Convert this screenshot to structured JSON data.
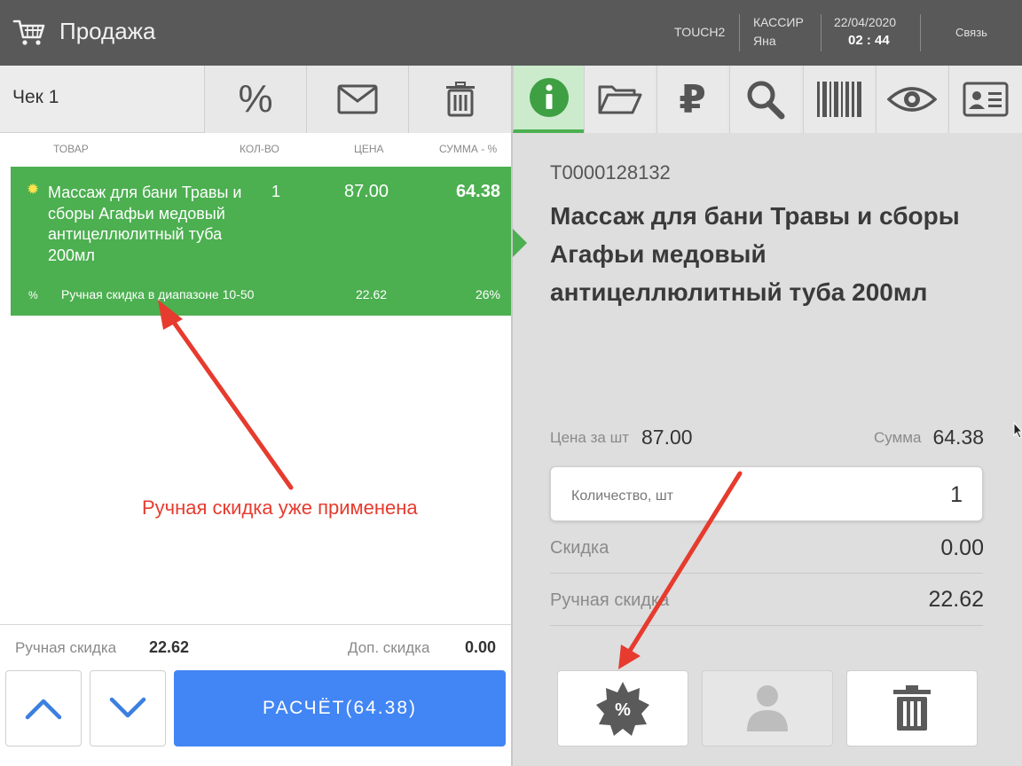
{
  "header": {
    "title": "Продажа",
    "terminal": "TOUCH2",
    "cashier_title": "КАССИР",
    "cashier_name": "Яна",
    "date": "22/04/2020",
    "time": "02 : 44",
    "link_label": "Связь"
  },
  "receipt": {
    "title": "Чек 1",
    "discount_button_symbol": "%"
  },
  "columns": {
    "item": "ТОВАР",
    "qty": "КОЛ-ВО",
    "price": "ЦЕНА",
    "sum": "СУММА - %"
  },
  "items": [
    {
      "name": "Массаж для бани Травы и сборы Агафьи медовый антицеллюлитный туба 200мл",
      "qty": "1",
      "price": "87.00",
      "sum": "64.38",
      "discount": {
        "symbol": "%",
        "label": "Ручная скидка в диапазоне 10-50",
        "amount": "22.62",
        "percent": "26%"
      }
    }
  ],
  "footer": {
    "manual_discount_label": "Ручная скидка",
    "manual_discount_value": "22.62",
    "extra_discount_label": "Доп. скидка",
    "extra_discount_value": "0.00",
    "pay_button": "РАСЧЁТ(64.38)"
  },
  "toolbar": {
    "tools": [
      "info-icon",
      "folder-icon",
      "ruble-icon",
      "search-icon",
      "barcode-icon",
      "eye-icon",
      "id-card-icon"
    ],
    "ruble_symbol": "₽"
  },
  "details": {
    "code": "Т0000128132",
    "name": "Массаж для бани Травы и сборы Агафьи медовый антицеллюлитный туба 200мл",
    "unit_price_label": "Цена за шт",
    "unit_price": "87.00",
    "sum_label": "Сумма",
    "sum": "64.38",
    "quantity_label": "Количество, шт",
    "quantity": "1",
    "discount_label": "Скидка",
    "discount": "0.00",
    "manual_discount_label": "Ручная скидка",
    "manual_discount": "22.62",
    "discount_badge_symbol": "%"
  },
  "annotation": {
    "text": "Ручная скидка уже применена",
    "color": "#e63b2e"
  },
  "colors": {
    "accent_green": "#4caf50",
    "pay_blue": "#4285f4",
    "header_bg": "#595959"
  }
}
